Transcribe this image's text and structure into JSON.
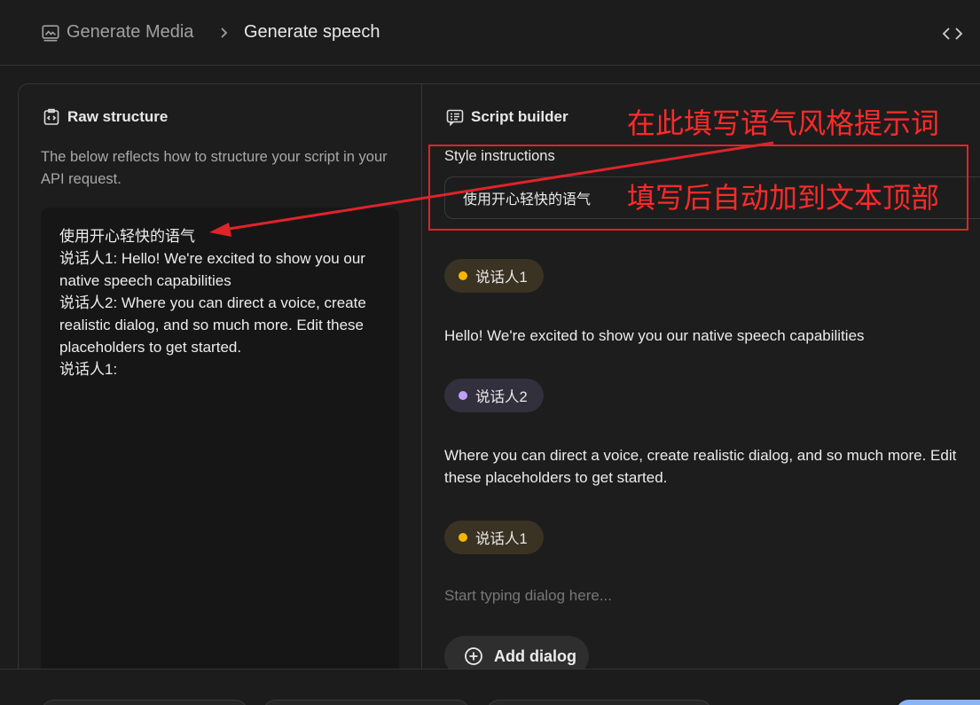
{
  "header": {
    "parent": "Generate Media",
    "current": "Generate speech"
  },
  "raw_structure": {
    "title": "Raw structure",
    "description": "The below reflects how to structure your script in your API request.",
    "lines": [
      "使用开心轻快的语气",
      "说话人1: Hello! We're excited to show you our native speech capabilities",
      "说话人2: Where you can direct a voice, create realistic dialog, and so much more. Edit these placeholders to get started.",
      "说话人1:"
    ]
  },
  "script_builder": {
    "title": "Script builder",
    "style_label": "Style instructions",
    "style_value": "使用开心轻快的语气",
    "dialogs": [
      {
        "speaker": "说话人1",
        "text": "Hello! We're excited to show you our native speech capabilities"
      },
      {
        "speaker": "说话人2",
        "text": "Where you can direct a voice, create realistic dialog, and so much more. Edit these placeholders to get started."
      },
      {
        "speaker": "说话人1",
        "placeholder": "Start typing dialog here..."
      }
    ],
    "add_label": "Add dialog"
  },
  "annotations": {
    "line1": "在此填写语气风格提示词",
    "line2": "填写后自动加到文本顶部"
  },
  "colors": {
    "speaker1": "#f5b800",
    "speaker2": "#c09ff8",
    "annotation": "#e0232b"
  }
}
